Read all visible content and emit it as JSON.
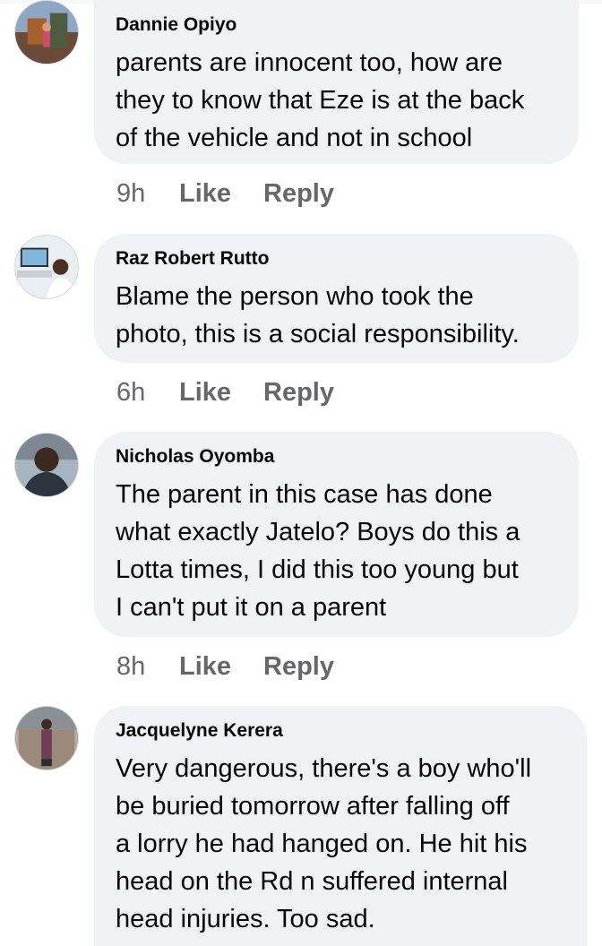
{
  "comments": [
    {
      "author": "Dannie Opiyo",
      "text": "parents are innocent too, how are\nthey to know that Eze is at the back\nof the vehicle and not in school",
      "time": "9h",
      "like_label": "Like",
      "reply_label": "Reply"
    },
    {
      "author": "Raz Robert Rutto",
      "text": "Blame the person who took the\nphoto, this is a social responsibility.",
      "time": "6h",
      "like_label": "Like",
      "reply_label": "Reply"
    },
    {
      "author": "Nicholas Oyomba",
      "text": "The parent in this case has done\nwhat exactly Jatelo? Boys do this a\nLotta times, I did this too young but\nI can't put it on a parent",
      "time": "8h",
      "like_label": "Like",
      "reply_label": "Reply"
    },
    {
      "author": "Jacquelyne Kerera",
      "text": "Very dangerous, there's a boy who'll\nbe buried tomorrow after falling off\na lorry he had hanged on. He hit his\nhead on the Rd n suffered internal\nhead injuries. Too sad.",
      "time": "",
      "like_label": "",
      "reply_label": ""
    }
  ],
  "colors": {
    "bubble": "#f0f2f5",
    "meta_text": "#65676b",
    "body_text": "#050505"
  },
  "icons": [
    "avatar-photo-dannie",
    "avatar-photo-raz",
    "avatar-photo-nicholas",
    "avatar-photo-jacquelyne"
  ]
}
